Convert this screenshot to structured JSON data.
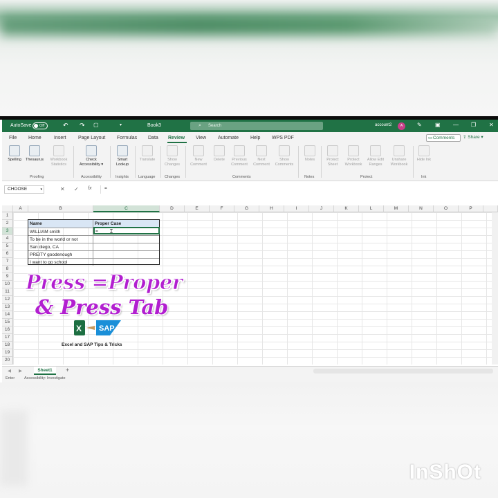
{
  "titlebar": {
    "autosave_label": "AutoSave",
    "autosave_state": "Off",
    "book_name": "Book3",
    "search_placeholder": "Search",
    "account": "account2",
    "avatar_initial": "A"
  },
  "menu": [
    "File",
    "Home",
    "Insert",
    "Page Layout",
    "Formulas",
    "Data",
    "Review",
    "View",
    "Automate",
    "Help",
    "WPS PDF"
  ],
  "menu_active": "Review",
  "menu_right": {
    "comments": "Comments",
    "share": "Share"
  },
  "ribbon": {
    "buttons": [
      {
        "label": "Spelling"
      },
      {
        "label": "Thesaurus"
      },
      {
        "label": "Workbook Statistics"
      },
      {
        "label": "Check Accessibility ▾"
      },
      {
        "label": "Smart Lookup"
      },
      {
        "label": "Translate"
      },
      {
        "label": "Show Changes"
      },
      {
        "label": "New Comment"
      },
      {
        "label": "Delete"
      },
      {
        "label": "Previous Comment"
      },
      {
        "label": "Next Comment"
      },
      {
        "label": "Show Comments"
      },
      {
        "label": "Notes"
      },
      {
        "label": "Protect Sheet"
      },
      {
        "label": "Protect Workbook"
      },
      {
        "label": "Allow Edit Ranges"
      },
      {
        "label": "Unshare Workbook"
      },
      {
        "label": "Hide Ink"
      }
    ],
    "groups": [
      "Proofing",
      "Accessibility",
      "Insights",
      "Language",
      "Changes",
      "Comments",
      "Notes",
      "Protect",
      "Ink"
    ]
  },
  "formula_bar": {
    "name_box": "CHOOSE",
    "cancel_icon": "✕",
    "enter_icon": "✓",
    "fx": "fx",
    "content": "="
  },
  "columns": [
    "A",
    "B",
    "C",
    "D",
    "E",
    "F",
    "G",
    "H",
    "I",
    "J",
    "K",
    "L",
    "M",
    "N",
    "O",
    "P"
  ],
  "rows": [
    "1",
    "2",
    "3",
    "4",
    "5",
    "6",
    "7",
    "8",
    "9",
    "10",
    "11",
    "12",
    "13",
    "14",
    "15",
    "16",
    "17",
    "18",
    "19",
    "20"
  ],
  "table": {
    "headers": [
      "Name",
      "Proper Case"
    ],
    "names": [
      "WILLIAM smith",
      "To be in the world or not",
      "San diego, CA",
      "PREITY goodenough",
      "I want to go school"
    ],
    "active_value": "="
  },
  "overlay": {
    "line1": "Press =Proper",
    "line2": "& Press Tab",
    "logo_text": "SAP",
    "brand": "Excel and SAP Tips & Tricks"
  },
  "sheet": {
    "tab": "Sheet1",
    "add": "+"
  },
  "status": {
    "mode": "Enter",
    "accessibility": "Accessibility: Investigate"
  },
  "watermark": "InShOt",
  "colors": {
    "excel_green": "#207245",
    "overlay_purple": "#b21fd0",
    "header_fill": "#d9e6f5"
  }
}
